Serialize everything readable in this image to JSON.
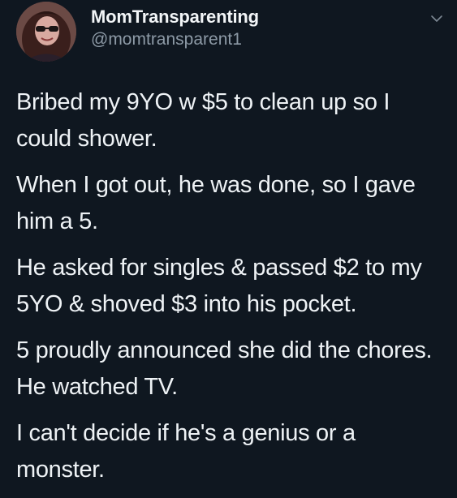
{
  "author": {
    "display_name": "MomTransparenting",
    "handle": "@momtransparent1",
    "avatar_icon": "profile-photo"
  },
  "menu": {
    "icon": "chevron-down-icon"
  },
  "tweet": {
    "paragraphs": [
      "Bribed my 9YO w $5 to clean up so I could shower.",
      "When I got out, he was done, so I gave him a 5.",
      "He asked for singles & passed $2 to my 5YO & shoved $3 into his pocket.",
      "5 proudly announced she did the chores. He watched TV.",
      "I can't decide if he's a genius or a monster."
    ]
  },
  "colors": {
    "background": "#0f1720",
    "text_primary": "#eef2f5",
    "text_secondary": "#8d9aa6"
  }
}
